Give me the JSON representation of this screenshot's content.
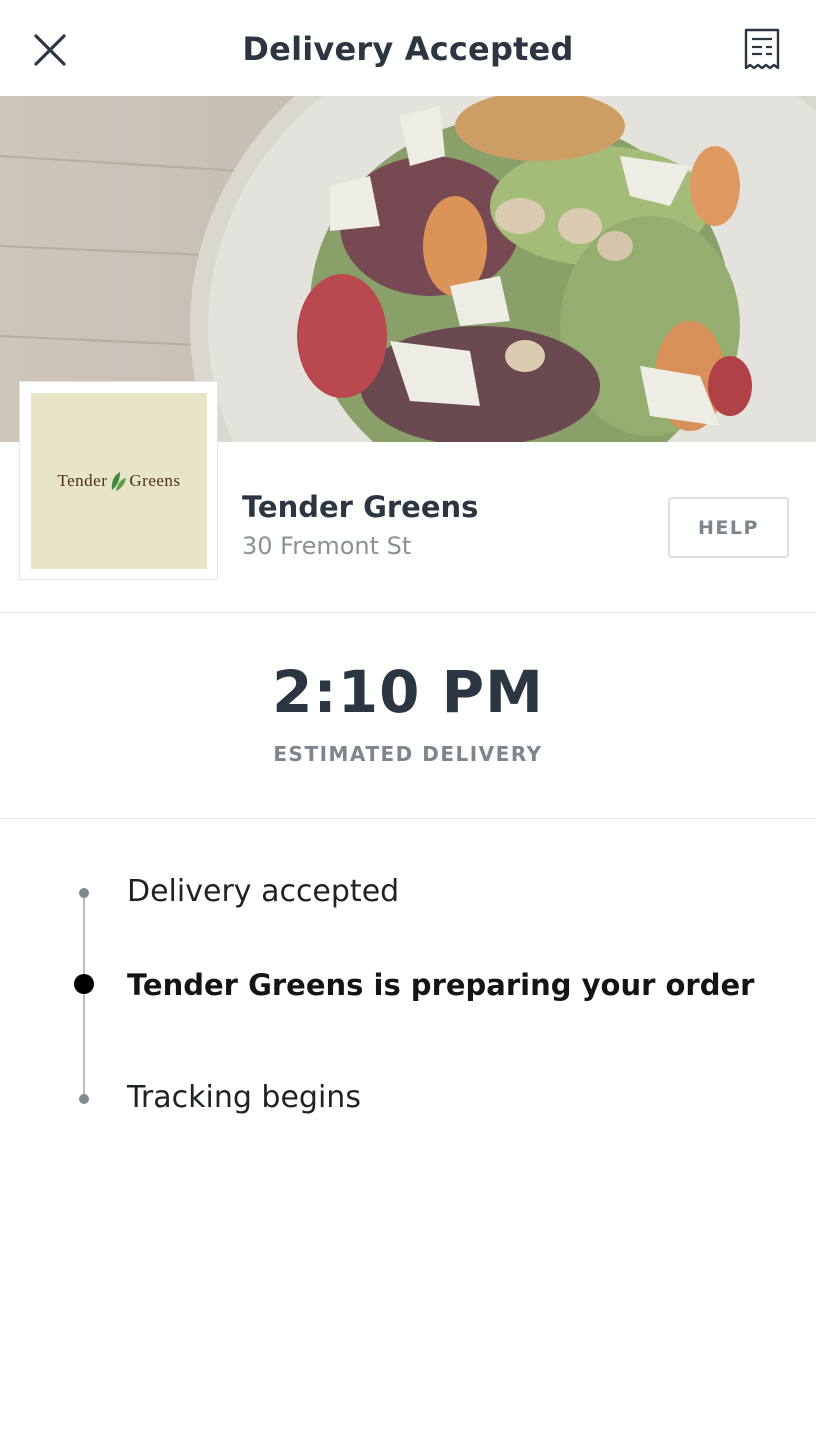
{
  "header": {
    "title": "Delivery Accepted",
    "close_icon": "close-icon",
    "receipt_icon": "receipt-icon"
  },
  "restaurant": {
    "logo_text_left": "Tender",
    "logo_text_right": "Greens",
    "name": "Tender Greens",
    "address": "30 Fremont St",
    "help_label": "HELP"
  },
  "eta": {
    "time": "2:10 PM",
    "label": "ESTIMATED DELIVERY"
  },
  "timeline": {
    "steps": [
      {
        "label": "Delivery accepted",
        "state": "done"
      },
      {
        "label": "Tender Greens is preparing your order",
        "state": "active"
      },
      {
        "label": "Tracking begins",
        "state": "pending"
      }
    ]
  },
  "colors": {
    "text_dark": "#2c3642",
    "text_muted": "#8a9097",
    "divider": "#e3e5e7",
    "logo_bg": "#e8e4c7",
    "timeline_dot": "#7f8a8c",
    "active_dot": "#000000"
  }
}
